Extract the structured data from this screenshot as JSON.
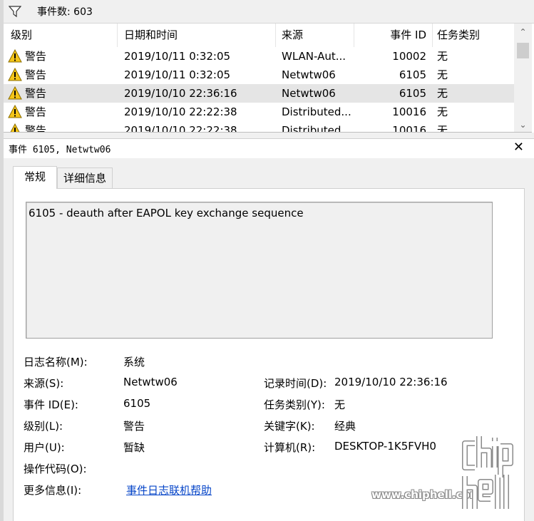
{
  "topbar": {
    "count_label": "事件数: 603"
  },
  "columns": [
    {
      "label": "级别"
    },
    {
      "label": "日期和时间"
    },
    {
      "label": "来源"
    },
    {
      "label": "事件 ID"
    },
    {
      "label": "任务类别"
    }
  ],
  "rows": [
    {
      "level": "警告",
      "datetime": "2019/10/11 0:32:05",
      "source": "WLAN-Aut...",
      "event_id": "10002",
      "task": "无"
    },
    {
      "level": "警告",
      "datetime": "2019/10/11 0:32:05",
      "source": "Netwtw06",
      "event_id": "6105",
      "task": "无"
    },
    {
      "level": "警告",
      "datetime": "2019/10/10 22:36:16",
      "source": "Netwtw06",
      "event_id": "6105",
      "task": "无"
    },
    {
      "level": "警告",
      "datetime": "2019/10/10 22:22:38",
      "source": "Distributed...",
      "event_id": "10016",
      "task": "无"
    },
    {
      "level": "警告",
      "datetime": "2019/10/10 22:22:38",
      "source": "Distributed...",
      "event_id": "10016",
      "task": "无"
    }
  ],
  "selected_row": 2,
  "detail": {
    "title": "事件 6105, Netwtw06",
    "tabs": [
      "常规",
      "详细信息"
    ],
    "description": "6105 - deauth after EAPOL key exchange sequence",
    "fields": {
      "log_name_label": "日志名称(M):",
      "log_name": "系统",
      "source_label": "来源(S):",
      "source": "Netwtw06",
      "logged_label": "记录时间(D):",
      "logged": "2019/10/10 22:36:16",
      "event_id_label": "事件 ID(E):",
      "event_id": "6105",
      "task_label": "任务类别(Y):",
      "task": "无",
      "level_label": "级别(L):",
      "level": "警告",
      "keywords_label": "关键字(K):",
      "keywords": "经典",
      "user_label": "用户(U):",
      "user": "暂缺",
      "computer_label": "计算机(R):",
      "computer": "DESKTOP-1K5FVH0",
      "opcode_label": "操作代码(O):",
      "more_info_label": "更多信息(I):",
      "more_info_link": "事件日志联机帮助"
    }
  },
  "watermark": {
    "site": "www.chiphell.com",
    "logo_text": "chiphell"
  },
  "colors": {
    "warning": "#f5c518",
    "link": "#0645c8",
    "selected_row": "#e5e5e5",
    "chrome": "#f0f0f0"
  },
  "icons": {
    "filter": "filter-icon",
    "warning": "warning-icon",
    "close": "close-icon",
    "scroll_up": "chevron-up-icon",
    "scroll_down": "chevron-down-icon"
  }
}
